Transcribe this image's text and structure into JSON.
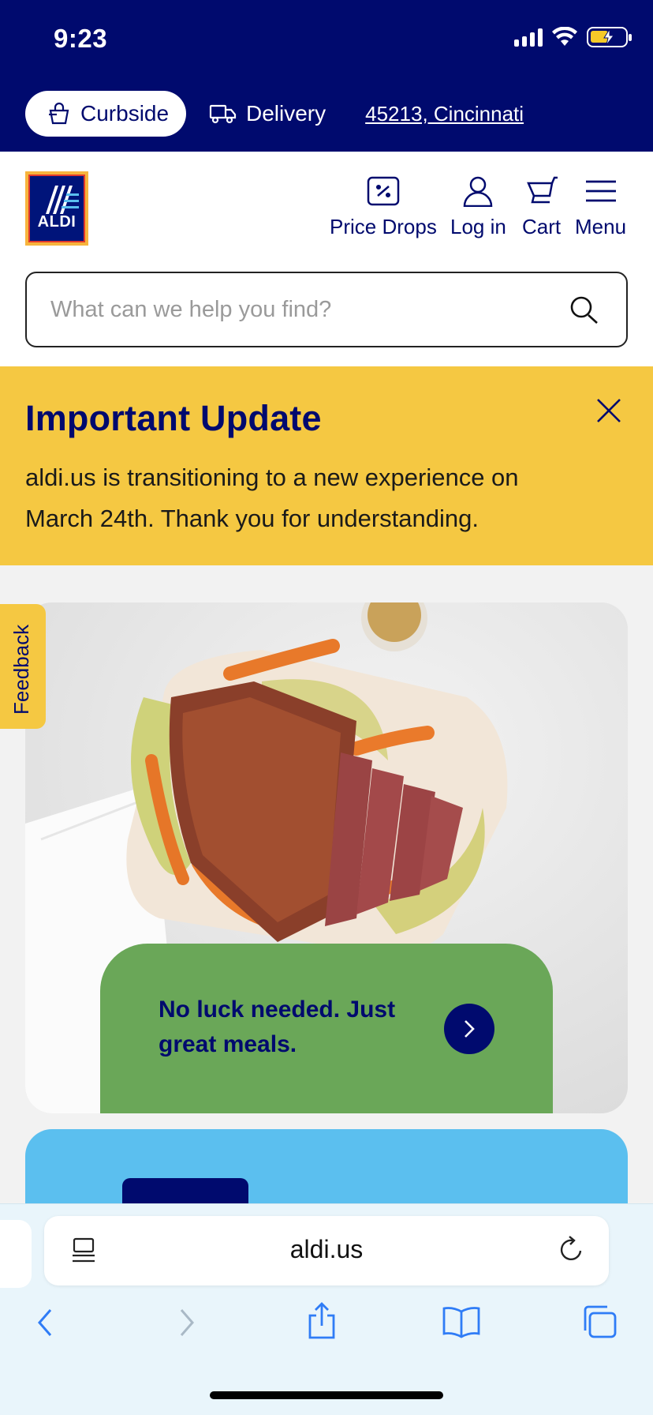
{
  "status": {
    "time": "9:23"
  },
  "fulfillment": {
    "curbside": "Curbside",
    "delivery": "Delivery",
    "location": "45213, Cincinnati"
  },
  "logo": {
    "text": "ALDI"
  },
  "nav": [
    {
      "label": "Price Drops",
      "icon": "price-tag-icon"
    },
    {
      "label": "Log in",
      "icon": "user-icon"
    },
    {
      "label": "Cart",
      "icon": "cart-icon"
    },
    {
      "label": "Menu",
      "icon": "hamburger-icon"
    }
  ],
  "search": {
    "placeholder": "What can we help you find?",
    "value": ""
  },
  "update": {
    "title": "Important Update",
    "body": "aldi.us is transitioning to a new experience on March 24th. Thank you for understanding."
  },
  "feedback": {
    "label": "Feedback"
  },
  "hero": {
    "headline": "No luck needed. Just great meals."
  },
  "browser": {
    "url": "aldi.us"
  },
  "colors": {
    "navy": "#000a6e",
    "yellow": "#f5c842",
    "green": "#6aa758",
    "blue": "#5bbfef"
  }
}
